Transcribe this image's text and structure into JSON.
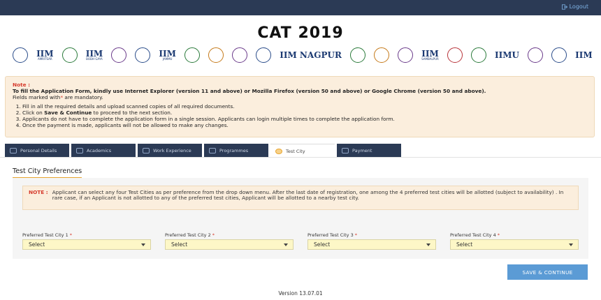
{
  "header": {
    "logout_label": "Logout",
    "title": "CAT 2019"
  },
  "logos": [
    {
      "icon": "seal-icon"
    },
    {
      "icon": "iim-amritsar-logo",
      "text": "IIM",
      "sub": "AMRITSAR"
    },
    {
      "icon": "seal-icon"
    },
    {
      "icon": "iim-bodh-gaya-logo",
      "text": "IIM",
      "sub": "BODH GAYA"
    },
    {
      "icon": "seal-icon"
    },
    {
      "icon": "seal-icon"
    },
    {
      "icon": "iim-jammu-logo",
      "text": "IIM",
      "sub": "JAMMU"
    },
    {
      "icon": "seal-icon"
    },
    {
      "icon": "seal-icon"
    },
    {
      "icon": "seal-icon"
    },
    {
      "icon": "seal-icon"
    },
    {
      "icon": "iim-nagpur-logo",
      "text": "IIM NAGPUR"
    },
    {
      "icon": "seal-icon"
    },
    {
      "icon": "seal-icon"
    },
    {
      "icon": "seal-icon"
    },
    {
      "icon": "iim-sambalpur-logo",
      "text": "IIM",
      "sub": "SAMBALPUR"
    },
    {
      "icon": "seal-icon"
    },
    {
      "icon": "seal-icon"
    },
    {
      "icon": "iimu-logo",
      "text": "IIMU"
    },
    {
      "icon": "seal-icon"
    },
    {
      "icon": "seal-icon"
    },
    {
      "icon": "iim-logo",
      "text": "IIM"
    }
  ],
  "note": {
    "label": "Note :",
    "browser_text": "To fill the Application Form, kindly use Internet Explorer (version 11 and above) or Mozilla Firefox (version 50 and above) or Google Chrome (version 50 and above).",
    "mandatory_prefix": "Fields marked with",
    "mandatory_star": "*",
    "mandatory_suffix": " are mandatory.",
    "item1": "Fill in all the required details and upload scanned copies of all required documents.",
    "item2_pre": "Click on ",
    "item2_bold": "Save & Continue",
    "item2_post": " to proceed to the next section.",
    "item3": "Applicants do not have to complete the application form in a single session. Applicants can login multiple times to complete the application form.",
    "item4": "Once the payment is made, applicants will not be allowed to make any changes."
  },
  "tabs": [
    {
      "label": "Personal Details"
    },
    {
      "label": "Academics"
    },
    {
      "label": "Work Experience"
    },
    {
      "label": "Programmes"
    },
    {
      "label": "Test City"
    },
    {
      "label": "Payment"
    }
  ],
  "section": {
    "title": "Test City Preferences",
    "info_label": "NOTE :",
    "info_text": "Applicant can select any four Test Cities as per preference from the drop down menu. After the last date of registration, one among the 4 preferred test cities will be allotted (subject to availability) . In rare case, if an Applicant is not allotted to any of the preferred test cities, Applicant will be allotted to a nearby test city."
  },
  "fields": [
    {
      "label": "Preferred Test City 1",
      "value": "Select"
    },
    {
      "label": "Preferred Test City 2",
      "value": "Select"
    },
    {
      "label": "Preferred Test City 3",
      "value": "Select"
    },
    {
      "label": "Preferred Test City 4",
      "value": "Select"
    }
  ],
  "required_marker": "*",
  "save_label": "SAVE & CONTINUE",
  "version": "Version 13.07.01",
  "colors": {
    "topbar": "#2b3a55",
    "accent": "#e8a530",
    "note_bg": "#fbeedd",
    "select_bg": "#fdf7c7",
    "button": "#5b9bd5",
    "required": "#d63b2d"
  }
}
